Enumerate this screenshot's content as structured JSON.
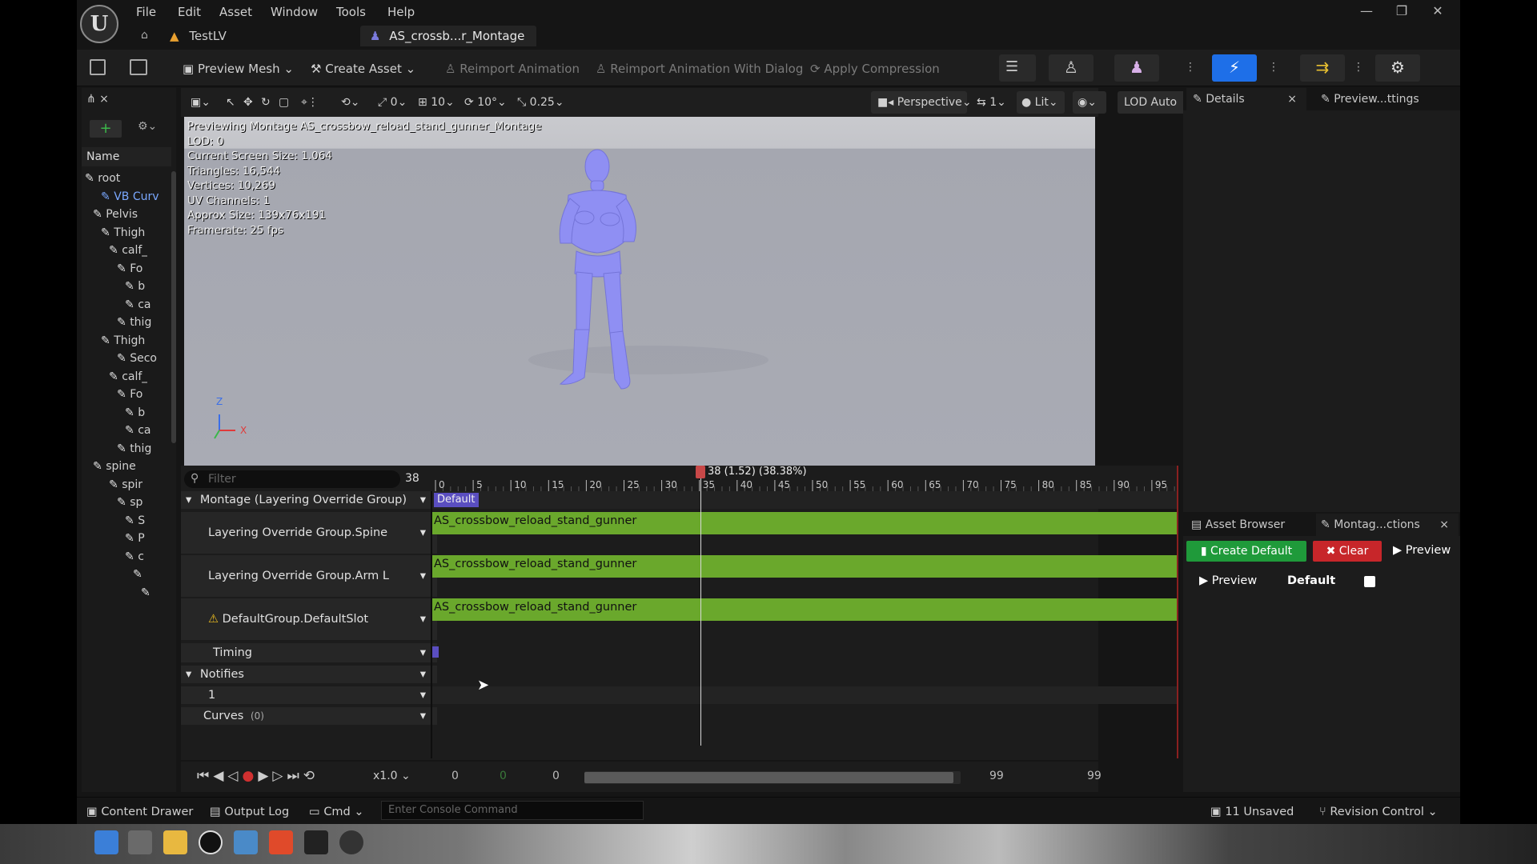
{
  "menu": [
    "File",
    "Edit",
    "Asset",
    "Window",
    "Tools",
    "Help"
  ],
  "tabs": {
    "level": "TestLV",
    "asset": "AS_crossb...r_Montage",
    "asset_modified": "•",
    "close": "×"
  },
  "window_controls": {
    "minimize": "—",
    "restore": "❐",
    "close": "✕"
  },
  "toolbar": {
    "preview_mesh": "Preview Mesh",
    "create_asset": "Create Asset",
    "reimport": "Reimport Animation",
    "reimport_dialog": "Reimport Animation With Dialog",
    "apply_compression": "Apply Compression"
  },
  "skeleton": {
    "header": "Name",
    "nodes": [
      "root",
      "VB Curv",
      "Pelvis",
      "Thigh",
      "calf_",
      "Fo",
      "b",
      "ca",
      "thig",
      "Thigh",
      "Seco",
      "calf_",
      "Fo",
      "b",
      "ca",
      "thig",
      "spine",
      "spir",
      "sp",
      "S",
      "P",
      "c",
      "",
      ""
    ]
  },
  "viewport_toolbar": {
    "translate_snap": "0",
    "grid": "10",
    "rotate_snap": "10°",
    "scale_snap": "0.25",
    "view_mode": "Perspective",
    "camera_speed": "1",
    "lighting": "Lit",
    "lod": "LOD Auto"
  },
  "viewport_info": [
    "Previewing Montage AS_crossbow_reload_stand_gunner_Montage",
    "LOD: 0",
    "Current Screen Size: 1.064",
    "Triangles: 16,544",
    "Vertices: 10,269",
    "UV Channels: 1",
    "Approx Size: 139x76x191",
    "Framerate: 25 fps"
  ],
  "axis": {
    "z": "Z",
    "x": "X"
  },
  "timeline": {
    "filter_placeholder": "Filter",
    "frame_count": "38",
    "playhead_label": "38 (1.52) (38.38%)",
    "ticks": [
      "0",
      "5",
      "10",
      "15",
      "20",
      "25",
      "30",
      "35",
      "40",
      "45",
      "50",
      "55",
      "60",
      "65",
      "70",
      "75",
      "80",
      "85",
      "90",
      "95"
    ],
    "section_label": "Default"
  },
  "tracks": [
    {
      "label": "Montage (Layering Override Group)",
      "type": "group"
    },
    {
      "label": "Layering Override Group.Spine",
      "clip": "AS_crossbow_reload_stand_gunner"
    },
    {
      "label": "Layering Override Group.Arm L",
      "clip": "AS_crossbow_reload_stand_gunner"
    },
    {
      "label": "DefaultGroup.DefaultSlot",
      "clip": "AS_crossbow_reload_stand_gunner",
      "warning": "⚠"
    },
    {
      "label": "Timing"
    },
    {
      "label": "Notifies",
      "type": "group"
    },
    {
      "label": "1"
    },
    {
      "label": "Curves",
      "count": "(0)",
      "type": "group"
    }
  ],
  "transport": {
    "speed": "x1.0",
    "range_start": "0",
    "view_start": "0",
    "current": "0",
    "view_end": "99",
    "range_end": "99"
  },
  "details": {
    "tab": "Details",
    "preview_tab": "Preview...ttings"
  },
  "asset_panel": {
    "tab_browser": "Asset Browser",
    "tab_montage": "Montag...ctions",
    "create_default": "Create Default",
    "clear": "Clear",
    "preview": "Preview",
    "preview2": "Preview",
    "default": "Default"
  },
  "statusbar": {
    "content_drawer": "Content Drawer",
    "output_log": "Output Log",
    "cmd": "Cmd",
    "console_placeholder": "Enter Console Command",
    "unsaved": "11 Unsaved",
    "revision": "Revision Control"
  },
  "colors": {
    "clip_green": "#6aa82c",
    "character": "#8f8ff3",
    "playhead": "#c84848",
    "accent_blue": "#1e6fe8",
    "create_green": "#1f9a3a",
    "clear_red": "#c7262a"
  }
}
